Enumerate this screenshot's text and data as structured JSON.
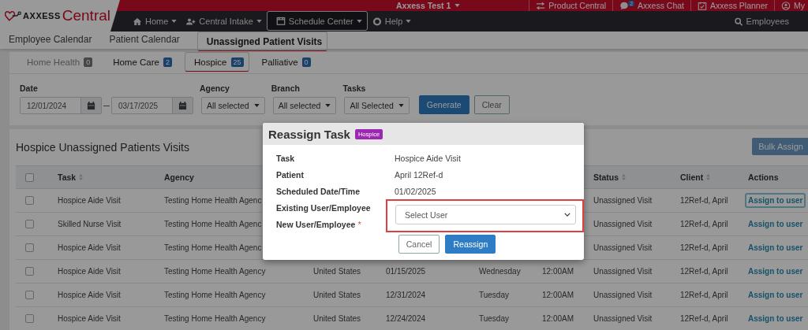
{
  "logo": {
    "brand": "AXXESS",
    "product": "Central"
  },
  "top_bar": {
    "account": "Axxess Test 1",
    "links": [
      {
        "label": "Product Central",
        "kind": "product"
      },
      {
        "label": "Axxess Chat",
        "kind": "chat",
        "badge": "2"
      },
      {
        "label": "Axxess Planner",
        "kind": "planner"
      },
      {
        "label": "My",
        "kind": "profile"
      }
    ]
  },
  "nav": {
    "items": [
      {
        "label": "Home",
        "kind": "home",
        "selected": false
      },
      {
        "label": "Central Intake",
        "kind": "intake",
        "selected": false
      },
      {
        "label": "Schedule Center",
        "kind": "schedule",
        "selected": true
      },
      {
        "label": "Help",
        "kind": "help",
        "selected": false
      }
    ],
    "search": {
      "label": "Employees"
    }
  },
  "subnav": [
    {
      "label": "Employee Calendar",
      "selected": false
    },
    {
      "label": "Patient Calendar",
      "selected": false
    },
    {
      "label": "Unassigned Patient Visits",
      "selected": true
    }
  ],
  "tabs": [
    {
      "label": "Home Health",
      "count": "0",
      "selected": false,
      "disabled": true
    },
    {
      "label": "Home Care",
      "count": "2",
      "selected": false,
      "disabled": false
    },
    {
      "label": "Hospice",
      "count": "25",
      "selected": true,
      "disabled": false
    },
    {
      "label": "Palliative",
      "count": "0",
      "selected": false,
      "disabled": false
    }
  ],
  "filters": {
    "date": {
      "label": "Date",
      "from": "12/01/2024",
      "to": "03/17/2025"
    },
    "dropdowns": [
      {
        "label": "Agency",
        "value": "All selected"
      },
      {
        "label": "Branch",
        "value": "All selected"
      },
      {
        "label": "Tasks",
        "value": "All Selected"
      }
    ],
    "buttons": [
      {
        "label": "Generate",
        "kind": "primary"
      },
      {
        "label": "Clear",
        "kind": "secondary"
      }
    ]
  },
  "table": {
    "title": "Hospice Unassigned Patients Visits",
    "bulk_button": "Bulk Assign",
    "select_all_checked": false,
    "columns": [
      {
        "label": "Task",
        "sortable": true
      },
      {
        "label": "Agency",
        "sortable": false
      },
      {
        "label": "Status",
        "sortable": true
      },
      {
        "label": "Client",
        "sortable": true
      },
      {
        "label": "Actions",
        "sortable": false
      }
    ],
    "rows": [
      {
        "checked": false,
        "task": "Hospice Aide Visit",
        "agency": "Testing Home Health Agenc",
        "status": "Unassigned Visit",
        "client": "12Ref-d, April",
        "action": {
          "label": "Assign to user",
          "focused": true
        }
      },
      {
        "checked": false,
        "task": "Skilled Nurse Visit",
        "agency": "Testing Home Health Agenc",
        "status": "Unassigned Visit",
        "client": "12Ref-d, April",
        "action": {
          "label": "Assign to user",
          "focused": false
        }
      },
      {
        "checked": false,
        "task": "Hospice Aide Visit",
        "agency": "Testing Home Health Agenc",
        "status": "Unassigned Visit",
        "client": "12Ref-d, April",
        "action": {
          "label": "Assign to user",
          "focused": false
        }
      },
      {
        "checked": false,
        "task": "Hospice Aide Visit",
        "agency": "Testing Home Health Agency",
        "column_4": "United States",
        "column_5": "01/15/2025",
        "column_6": "Wednesday",
        "column_7": "12:00AM",
        "status": "Unassigned Visit",
        "client": "12Ref-d, April",
        "action": {
          "label": "Assign to user",
          "focused": false
        }
      },
      {
        "checked": false,
        "task": "Hospice Aide Visit",
        "agency": "Testing Home Health Agency",
        "column_4": "United States",
        "column_5": "12/31/2024",
        "column_6": "Tuesday",
        "column_7": "12:00AM",
        "status": "Unassigned Visit",
        "client": "12Ref-d, April",
        "action": {
          "label": "Assign to user",
          "focused": false
        }
      },
      {
        "checked": false,
        "task": "Hospice Aide Visit",
        "agency": "Testing Home Health Agency",
        "column_4": "United States",
        "column_5": "12/24/2024",
        "column_6": "Tuesday",
        "column_7": "12:00AM",
        "status": "Unassigned Visit",
        "client": "12Ref-d, April",
        "action": {
          "label": "Assign to user",
          "focused": false
        }
      }
    ]
  },
  "dialog": {
    "title": "Reassign Task",
    "badge": "Hospice",
    "fields": [
      {
        "label": "Task",
        "value": "Hospice Aide Visit"
      },
      {
        "label": "Patient",
        "value": "April 12Ref-d"
      },
      {
        "label": "Scheduled Date/Time",
        "value": "01/02/2025"
      },
      {
        "label": "Existing User/Employee"
      },
      {
        "label": "New User/Employee",
        "required_mark": "*"
      }
    ],
    "select": {
      "placeholder": "Select User",
      "highlighted": true
    },
    "buttons": [
      {
        "label": "Cancel",
        "kind": "secondary"
      },
      {
        "label": "Reassign",
        "kind": "primary"
      }
    ]
  }
}
